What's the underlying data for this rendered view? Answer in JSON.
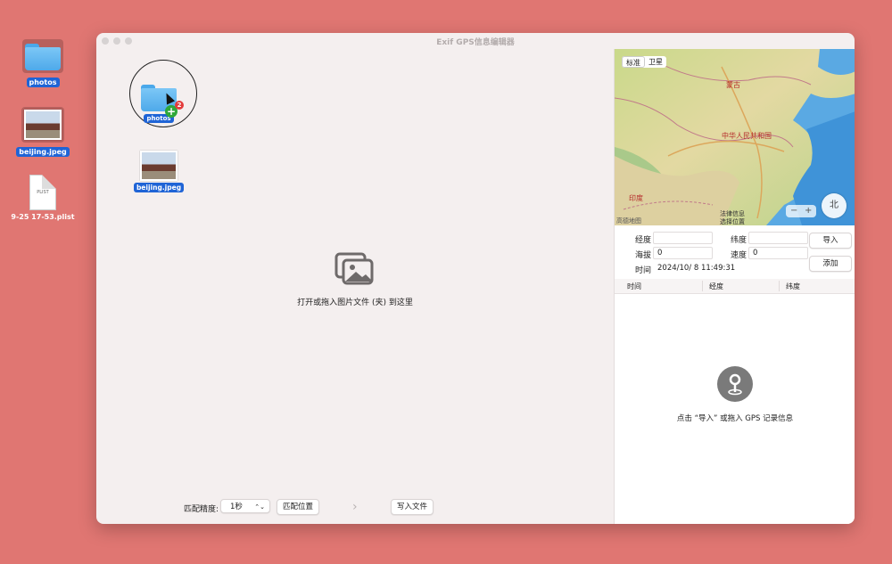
{
  "desktop": {
    "items": [
      {
        "label": "photos"
      },
      {
        "label": "beijing.jpeg"
      },
      {
        "label": "9-25 17-53.plist",
        "icon_text": "PLIST"
      }
    ]
  },
  "window": {
    "title": "Exif GPS信息编辑器"
  },
  "left_pane": {
    "dragging_folder_label": "photos",
    "drag_count": "2",
    "dropped_file_label": "beijing.jpeg",
    "drop_hint": "打开或拖入图片文件 (夹) 到这里",
    "bottom": {
      "match_precision_label": "匹配精度:",
      "match_precision_value": "1秒",
      "match_location_button": "匹配位置",
      "next_arrow": "›",
      "write_file_button": "写入文件"
    }
  },
  "map": {
    "mode_standard": "标准",
    "mode_satellite": "卫星",
    "labels": {
      "mongolia": "蒙古",
      "china": "中华人民共和国",
      "india": "印度",
      "attribution": "高德地图",
      "legal": "法律信息",
      "location_tip": "选择位置"
    },
    "zoom_out": "−",
    "zoom_in": "+",
    "compass": "北"
  },
  "gps_form": {
    "longitude_label": "经度",
    "longitude_value": "",
    "latitude_label": "纬度",
    "latitude_value": "",
    "altitude_label": "海拔",
    "altitude_value": "0",
    "speed_label": "速度",
    "speed_value": "0",
    "time_label": "时间",
    "time_value": "2024/10/  8 11:49:31",
    "import_button": "导入",
    "add_button": "添加"
  },
  "records_table": {
    "columns": [
      "时间",
      "经度",
      "纬度"
    ],
    "empty_hint": "点击 “导入” 或拖入 GPS 记录信息"
  },
  "colors": {
    "desktop_bg": "#e07672",
    "selection_blue": "#1f64d6",
    "add_badge_green": "#2fa83a",
    "count_badge_red": "#e33b3b"
  }
}
